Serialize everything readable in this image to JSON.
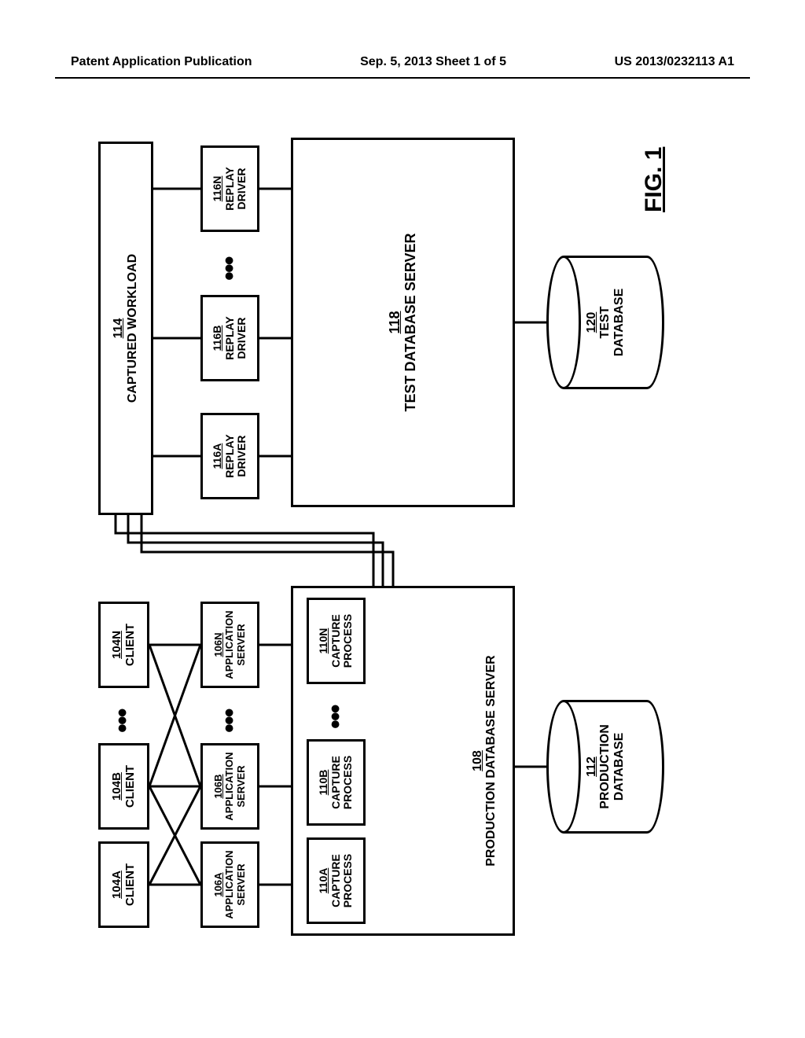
{
  "header": {
    "left": "Patent Application Publication",
    "center": "Sep. 5, 2013   Sheet 1 of 5",
    "right": "US 2013/0232113 A1"
  },
  "figure_label": "FIG. 1",
  "clients": {
    "a": {
      "ref": "104A",
      "label": "CLIENT"
    },
    "b": {
      "ref": "104B",
      "label": "CLIENT"
    },
    "n": {
      "ref": "104N",
      "label": "CLIENT"
    }
  },
  "app_servers": {
    "a": {
      "ref": "106A",
      "label1": "APPLICATION",
      "label2": "SERVER"
    },
    "b": {
      "ref": "106B",
      "label1": "APPLICATION",
      "label2": "SERVER"
    },
    "n": {
      "ref": "106N",
      "label1": "APPLICATION",
      "label2": "SERVER"
    }
  },
  "capture_processes": {
    "a": {
      "ref": "110A",
      "label1": "CAPTURE",
      "label2": "PROCESS"
    },
    "b": {
      "ref": "110B",
      "label1": "CAPTURE",
      "label2": "PROCESS"
    },
    "n": {
      "ref": "110N",
      "label1": "CAPTURE",
      "label2": "PROCESS"
    }
  },
  "production_db_server": {
    "ref": "108",
    "label": "PRODUCTION DATABASE SERVER"
  },
  "production_db": {
    "ref": "112",
    "label1": "PRODUCTION",
    "label2": "DATABASE"
  },
  "captured_workload": {
    "ref": "114",
    "label": "CAPTURED WORKLOAD"
  },
  "replay_drivers": {
    "a": {
      "ref": "116A",
      "label1": "REPLAY",
      "label2": "DRIVER"
    },
    "b": {
      "ref": "116B",
      "label1": "REPLAY",
      "label2": "DRIVER"
    },
    "n": {
      "ref": "116N",
      "label1": "REPLAY",
      "label2": "DRIVER"
    }
  },
  "test_db_server": {
    "ref": "118",
    "label": "TEST DATABASE SERVER"
  },
  "test_db": {
    "ref": "120",
    "label1": "TEST",
    "label2": "DATABASE"
  },
  "ellipsis": "•••",
  "chart_data": {
    "type": "diagram",
    "title": "FIG. 1",
    "nodes": [
      {
        "id": "104A",
        "label": "CLIENT"
      },
      {
        "id": "104B",
        "label": "CLIENT"
      },
      {
        "id": "104N",
        "label": "CLIENT"
      },
      {
        "id": "106A",
        "label": "APPLICATION SERVER"
      },
      {
        "id": "106B",
        "label": "APPLICATION SERVER"
      },
      {
        "id": "106N",
        "label": "APPLICATION SERVER"
      },
      {
        "id": "108",
        "label": "PRODUCTION DATABASE SERVER",
        "contains": [
          "110A",
          "110B",
          "110N"
        ]
      },
      {
        "id": "110A",
        "label": "CAPTURE PROCESS"
      },
      {
        "id": "110B",
        "label": "CAPTURE PROCESS"
      },
      {
        "id": "110N",
        "label": "CAPTURE PROCESS"
      },
      {
        "id": "112",
        "label": "PRODUCTION DATABASE",
        "shape": "cylinder"
      },
      {
        "id": "114",
        "label": "CAPTURED WORKLOAD"
      },
      {
        "id": "116A",
        "label": "REPLAY DRIVER"
      },
      {
        "id": "116B",
        "label": "REPLAY DRIVER"
      },
      {
        "id": "116N",
        "label": "REPLAY DRIVER"
      },
      {
        "id": "118",
        "label": "TEST DATABASE SERVER"
      },
      {
        "id": "120",
        "label": "TEST DATABASE",
        "shape": "cylinder"
      }
    ],
    "ellipsis_groups": [
      [
        "104A",
        "104B",
        "104N"
      ],
      [
        "106A",
        "106B",
        "106N"
      ],
      [
        "110A",
        "110B",
        "110N"
      ],
      [
        "116A",
        "116B",
        "116N"
      ]
    ],
    "edges": [
      [
        "104A",
        "106A"
      ],
      [
        "104A",
        "106B"
      ],
      [
        "104B",
        "106A"
      ],
      [
        "104B",
        "106B"
      ],
      [
        "104B",
        "106N"
      ],
      [
        "104N",
        "106B"
      ],
      [
        "104N",
        "106N"
      ],
      [
        "106A",
        "108"
      ],
      [
        "106B",
        "108"
      ],
      [
        "106N",
        "108"
      ],
      [
        "108",
        "112"
      ],
      [
        "110A",
        "114"
      ],
      [
        "110B",
        "114"
      ],
      [
        "110N",
        "114"
      ],
      [
        "114",
        "116A"
      ],
      [
        "114",
        "116B"
      ],
      [
        "114",
        "116N"
      ],
      [
        "116A",
        "118"
      ],
      [
        "116B",
        "118"
      ],
      [
        "116N",
        "118"
      ],
      [
        "118",
        "120"
      ]
    ]
  }
}
